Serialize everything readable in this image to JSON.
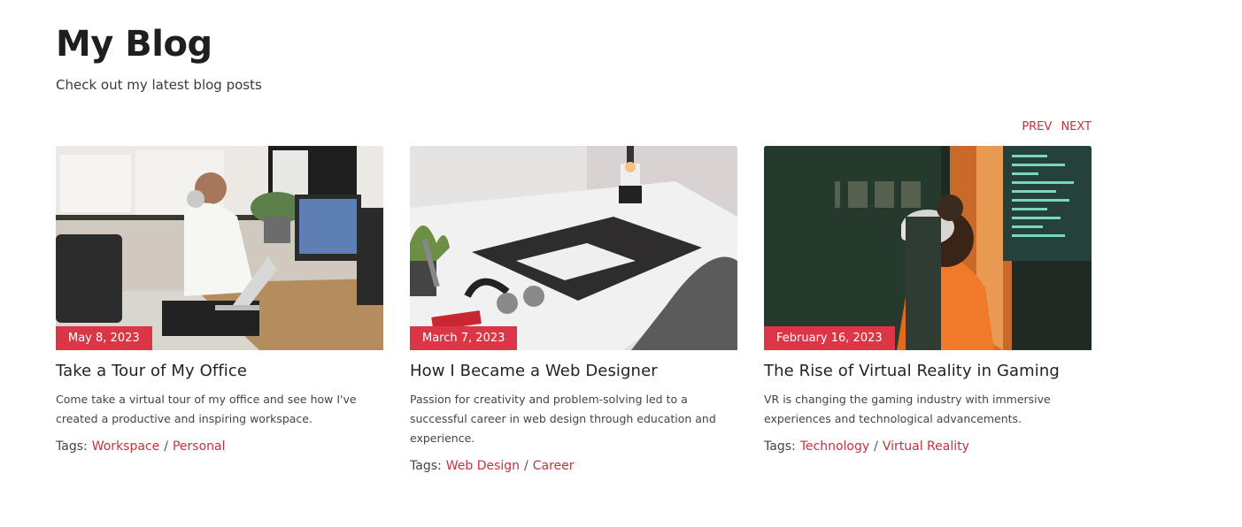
{
  "header": {
    "title": "My Blog",
    "subtitle": "Check out my latest blog posts"
  },
  "pager": {
    "prev_label": "PREV",
    "next_label": "NEXT"
  },
  "colors": {
    "accent": "#dc3545",
    "link": "#c8303f"
  },
  "tags_label": "Tags:",
  "tag_separator": "/",
  "posts": [
    {
      "date": "May 8, 2023",
      "title": "Take a Tour of My Office",
      "description": "Come take a virtual tour of my office and see how I've created a productive and inspiring workspace.",
      "tags": [
        "Workspace",
        "Personal"
      ],
      "image": "office-photo"
    },
    {
      "date": "March 7, 2023",
      "title": "How I Became a Web Designer",
      "description": "Passion for creativity and problem-solving led to a successful career in web design through education and experience.",
      "tags": [
        "Web Design",
        "Career"
      ],
      "image": "desk-laptop-photo"
    },
    {
      "date": "February 16, 2023",
      "title": "The Rise of Virtual Reality in Gaming",
      "description": "VR is changing the gaming industry with immersive experiences and technological advancements.",
      "tags": [
        "Technology",
        "Virtual Reality"
      ],
      "image": "vr-headset-photo"
    }
  ]
}
